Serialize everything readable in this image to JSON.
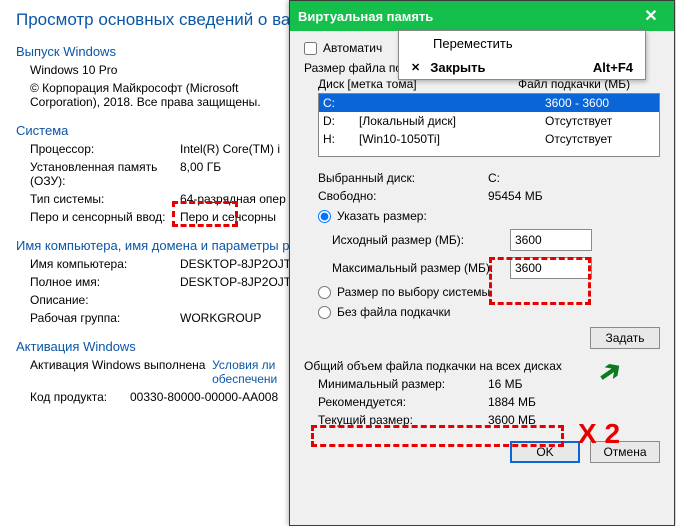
{
  "bg": {
    "title": "Просмотр основных сведений о ваше",
    "section_release": "Выпуск Windows",
    "release_name": "Windows 10 Pro",
    "copyright": "© Корпорация Майкрософт (Microsoft Corporation), 2018. Все права защищены.",
    "section_system": "Система",
    "cpu_lbl": "Процессор:",
    "cpu_val": "Intel(R) Core(TM) i",
    "ram_lbl": "Установленная память (ОЗУ):",
    "ram_val": "8,00 ГБ",
    "type_lbl": "Тип системы:",
    "type_val": "64-разрядная опер",
    "pen_lbl": "Перо и сенсорный ввод:",
    "pen_val": "Перо и сенсорны",
    "section_name": "Имя компьютера, имя домена и параметры раб",
    "comp_lbl": "Имя компьютера:",
    "comp_val": "DESKTOP-8JP2OJT",
    "full_lbl": "Полное имя:",
    "full_val": "DESKTOP-8JP2OJT",
    "desc_lbl": "Описание:",
    "desc_val": "",
    "wg_lbl": "Рабочая группа:",
    "wg_val": "WORKGROUP",
    "section_activation": "Активация Windows",
    "act_lbl": "Активация Windows выполнена",
    "act_link": "Условия ли\nобеспечени",
    "key_lbl": "Код продукта:",
    "key_val": "00330-80000-00000-AA008"
  },
  "dlg": {
    "title": "Виртуальная память",
    "close_glyph": "✕",
    "auto_label": "Автоматич",
    "group": "Размер файла подкачки для каждого диска",
    "hdr_disk": "Диск [метка тома]",
    "hdr_file": "Файл подкачки (МБ)",
    "disks": [
      {
        "letter": "C:",
        "label": "",
        "page": "3600 - 3600",
        "sel": true
      },
      {
        "letter": "D:",
        "label": "[Локальный диск]",
        "page": "Отсутствует",
        "sel": false
      },
      {
        "letter": "H:",
        "label": "[Win10-1050Ti]",
        "page": "Отсутствует",
        "sel": false
      }
    ],
    "seldisk_lbl": "Выбранный диск:",
    "seldisk_val": "C:",
    "free_lbl": "Свободно:",
    "free_val": "95454 МБ",
    "opt_custom": "Указать размер:",
    "init_lbl": "Исходный размер (МБ):",
    "init_val": "3600",
    "max_lbl": "Максимальный размер (МБ):",
    "max_val": "3600",
    "opt_system": "Размер по выбору системы",
    "opt_none": "Без файла подкачки",
    "set_btn": "Задать",
    "total_group": "Общий объем файла подкачки на всех дисках",
    "min_lbl": "Минимальный размер:",
    "min_val": "16 МБ",
    "rec_lbl": "Рекомендуется:",
    "rec_val": "1884 МБ",
    "cur_lbl": "Текущий размер:",
    "cur_val": "3600 МБ",
    "ok": "OK",
    "cancel": "Отмена"
  },
  "ctx": {
    "move": "Переместить",
    "close": "Закрыть",
    "close_sc": "Alt+F4"
  },
  "annot": {
    "x2": "X 2",
    "arrow": "➔"
  }
}
